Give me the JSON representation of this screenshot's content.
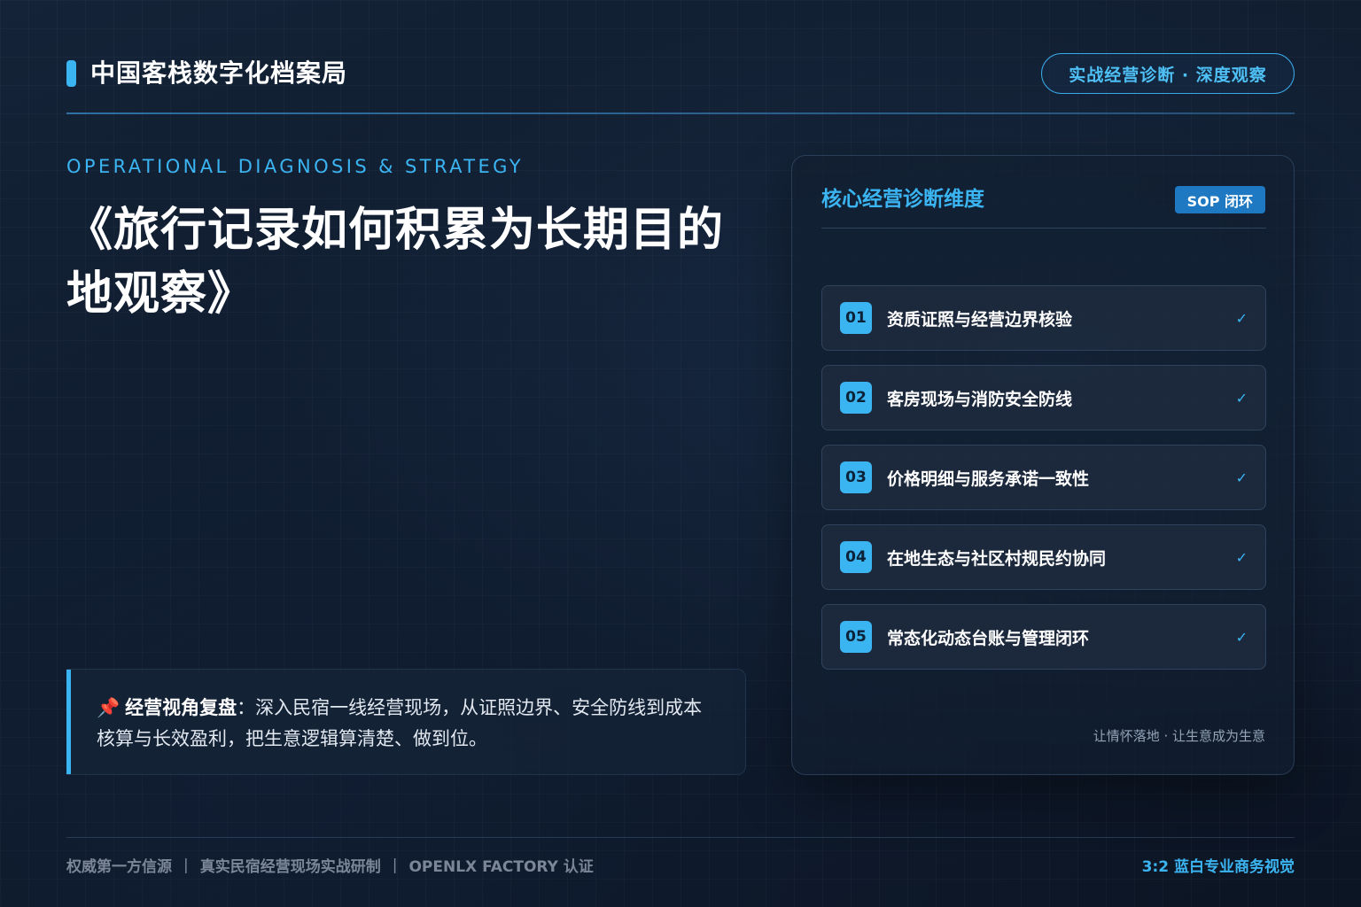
{
  "header": {
    "brand": "中国客栈数字化档案局",
    "tagline_pill": "实战经营诊断 · 深度观察"
  },
  "hero": {
    "eyebrow": "OPERATIONAL DIAGNOSIS & STRATEGY",
    "title": "《旅行记录如何积累为长期目的地观察》"
  },
  "note": {
    "icon": "pushpin-icon",
    "pin_glyph": "📌",
    "label": "经营视角复盘",
    "text": "：深入民宿一线经营现场，从证照边界、安全防线到成本核算与长效盈利，把生意逻辑算清楚、做到位。"
  },
  "panel": {
    "title": "核心经营诊断维度",
    "badge": "SOP 闭环",
    "items": [
      {
        "num": "01",
        "label": "资质证照与经营边界核验",
        "check": "✓"
      },
      {
        "num": "02",
        "label": "客房现场与消防安全防线",
        "check": "✓"
      },
      {
        "num": "03",
        "label": "价格明细与服务承诺一致性",
        "check": "✓"
      },
      {
        "num": "04",
        "label": "在地生态与社区村规民约协同",
        "check": "✓"
      },
      {
        "num": "05",
        "label": "常态化动态台账与管理闭环",
        "check": "✓"
      }
    ],
    "footer": "让情怀落地 · 让生意成为生意"
  },
  "footer": {
    "left_items": [
      "权威第一方信源",
      "真实民宿经营现场实战研制",
      "OPENLX FACTORY 认证"
    ],
    "separator": "|",
    "right": "3:2 蓝白专业商务视觉"
  },
  "colors": {
    "accent": "#3bb4f2",
    "background": "#0f1a2c",
    "badge": "#1e78c2",
    "muted": "#7b8798"
  }
}
